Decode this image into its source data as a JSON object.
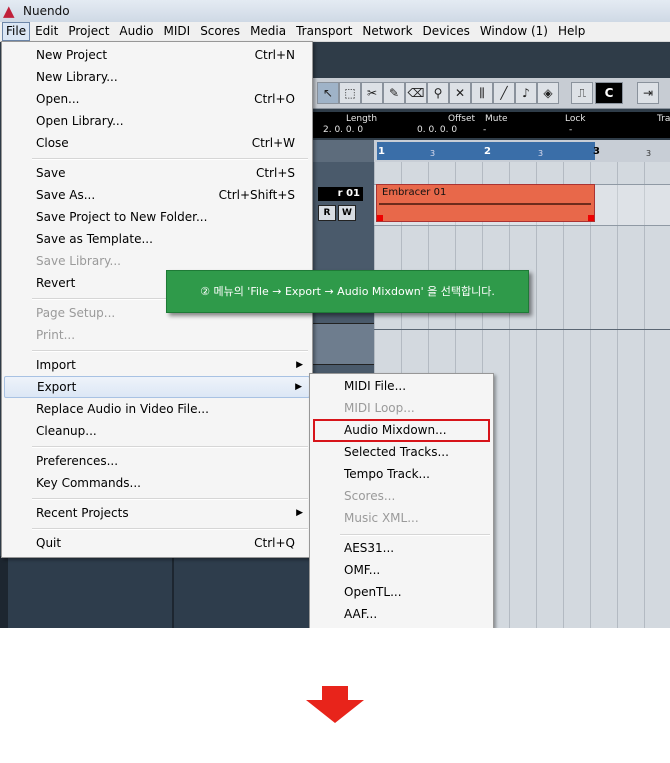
{
  "window": {
    "title": "Nuendo"
  },
  "menubar": [
    "File",
    "Edit",
    "Project",
    "Audio",
    "MIDI",
    "Scores",
    "Media",
    "Transport",
    "Network",
    "Devices",
    "Window (1)",
    "Help"
  ],
  "file_menu": {
    "items": [
      {
        "label": "New Project",
        "shortcut": "Ctrl+N"
      },
      {
        "label": "New Library...",
        "shortcut": ""
      },
      {
        "label": "Open...",
        "shortcut": "Ctrl+O"
      },
      {
        "label": "Open Library...",
        "shortcut": ""
      },
      {
        "label": "Close",
        "shortcut": "Ctrl+W"
      },
      {
        "label": "Save",
        "shortcut": "Ctrl+S"
      },
      {
        "label": "Save As...",
        "shortcut": "Ctrl+Shift+S"
      },
      {
        "label": "Save Project to New Folder...",
        "shortcut": ""
      },
      {
        "label": "Save as Template...",
        "shortcut": ""
      },
      {
        "label": "Save Library...",
        "shortcut": ""
      },
      {
        "label": "Revert",
        "shortcut": ""
      },
      {
        "label": "Page Setup...",
        "shortcut": ""
      },
      {
        "label": "Print...",
        "shortcut": ""
      },
      {
        "label": "Import",
        "shortcut": ""
      },
      {
        "label": "Export",
        "shortcut": ""
      },
      {
        "label": "Replace Audio in Video File...",
        "shortcut": ""
      },
      {
        "label": "Cleanup...",
        "shortcut": ""
      },
      {
        "label": "Preferences...",
        "shortcut": ""
      },
      {
        "label": "Key Commands...",
        "shortcut": ""
      },
      {
        "label": "Recent Projects",
        "shortcut": ""
      },
      {
        "label": "Quit",
        "shortcut": "Ctrl+Q"
      }
    ]
  },
  "export_submenu": {
    "items": [
      {
        "label": "MIDI File..."
      },
      {
        "label": "MIDI Loop..."
      },
      {
        "label": "Audio Mixdown..."
      },
      {
        "label": "Selected Tracks..."
      },
      {
        "label": "Tempo Track..."
      },
      {
        "label": "Scores..."
      },
      {
        "label": "Music XML..."
      },
      {
        "label": "AES31..."
      },
      {
        "label": "OMF..."
      },
      {
        "label": "OpenTL..."
      },
      {
        "label": "AAF..."
      }
    ]
  },
  "callout": {
    "text": "② 메뉴의 'File → Export → Audio Mixdown' 을 선택합니다."
  },
  "transport": {
    "length_label": "Length",
    "offset_label": "Offset",
    "mute_label": "Mute",
    "lock_label": "Lock",
    "tr_label": "Tra",
    "start_value": "2. 0. 0.  0",
    "length_value": "0. 0. 0.  0",
    "mute_value": "-",
    "lock_value": "-",
    "quantize_value": "C"
  },
  "ruler": {
    "marks": [
      "1",
      "3",
      "2",
      "3",
      "3",
      "3"
    ]
  },
  "track": {
    "name": "r 01",
    "part_name": "Embracer 01",
    "rw": [
      "R",
      "W"
    ]
  },
  "colors": {
    "callout_bg": "#2f9a4a",
    "highlight_border": "#d7141a",
    "part_color": "#e8684a",
    "arrow": "#e8241b"
  }
}
